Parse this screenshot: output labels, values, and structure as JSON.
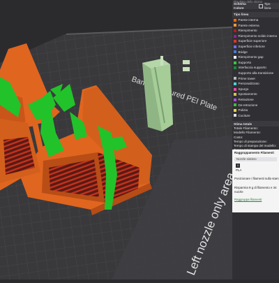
{
  "viewport": {
    "plate_text_top": "Bambu Textured PEI Plate",
    "plate_text_bottom": "Left nozzle only area"
  },
  "panel": {
    "title": "Risultato dello slicing",
    "scheme_label": "Schema Colore",
    "scheme_value": "Tipo linea",
    "type_header": "Tipo linea",
    "legend": [
      {
        "label": "Parete interna",
        "color": "#ff6a00"
      },
      {
        "label": "Parete esterna",
        "color": "#ff9a3c"
      },
      {
        "label": "Riempimento",
        "color": "#b01c1c"
      },
      {
        "label": "Riempimento solido interno",
        "color": "#9a1e9a"
      },
      {
        "label": "Superficie superiore",
        "color": "#e0342b"
      },
      {
        "label": "Superficie inferiore",
        "color": "#6e6eff"
      },
      {
        "label": "Bridge",
        "color": "#4a7bd1"
      },
      {
        "label": "Riempimento gap",
        "color": "#ffffff"
      },
      {
        "label": "Supporto",
        "color": "#2ecc40"
      },
      {
        "label": "Interfaccia supporto",
        "color": "#1e8a3c"
      },
      {
        "label": "Supporto alla transizione",
        "color": ""
      },
      {
        "label": "Prime tower",
        "color": "#b8b8b8"
      },
      {
        "label": "Personalizzato",
        "color": "#4fd1d9"
      },
      {
        "label": "Spurgo",
        "color": "#e84aa0"
      },
      {
        "label": "Spostamento",
        "color": "#d6c84a"
      },
      {
        "label": "Retrazione",
        "color": "#ad4fd9"
      },
      {
        "label": "De-retrazione",
        "color": "#3fbf3f"
      },
      {
        "label": "Pulizia",
        "color": "#e6d24a"
      },
      {
        "label": "Cuciture",
        "color": "#e0e0e0"
      }
    ],
    "estimate_header": "Stima totale",
    "estimates": [
      "Totale Filamento:",
      "Modello Filamento:",
      "Costo:",
      "Tempo di preparazione:",
      "Tempo di stampa del modello:",
      "Tempo totale:"
    ],
    "group": {
      "title": "Raggruppamento Filamenti",
      "nozzle": "Nozzle sinistro",
      "chip": "1",
      "material": "PLA",
      "position_text": "Posizionare i filamenti sulla stampa",
      "saving_line1": "Risparmia 9 g di filamento e 34",
      "saving_line2": "nozzle",
      "link": "Raggruppa filamenti"
    }
  },
  "colors": {
    "bed_dark": "#38383b",
    "bed_light": "#46464a",
    "model_orange": "#e0651f",
    "infill_red": "#b52a20",
    "support_green": "#22c22b",
    "tower_green": "#9dc48c",
    "panel_bg": "#303034"
  }
}
